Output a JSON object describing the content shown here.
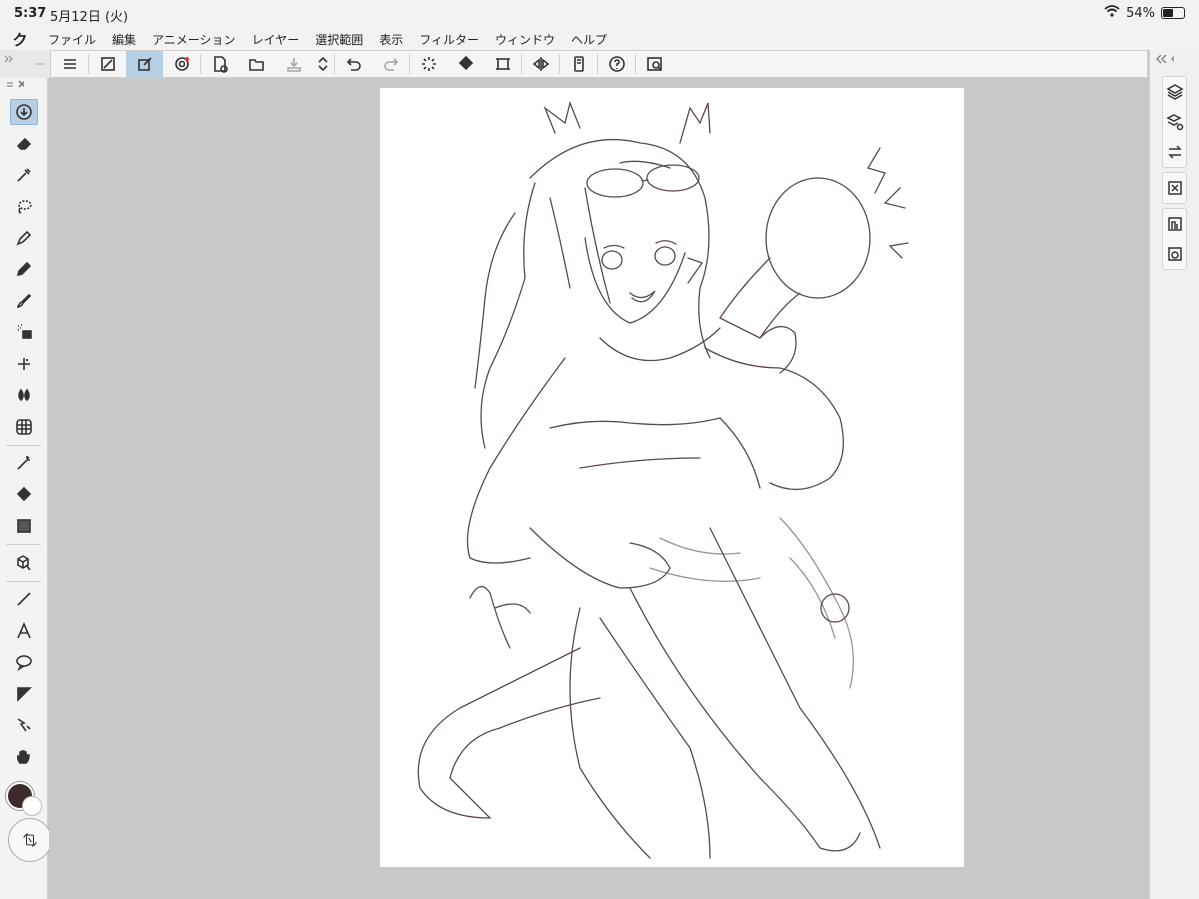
{
  "status": {
    "time": "5:37",
    "date": "5月12日 (火)",
    "battery": "54%"
  },
  "menu": [
    "ファイル",
    "編集",
    "アニメーション",
    "レイヤー",
    "選択範囲",
    "表示",
    "フィルター",
    "ウィンドウ",
    "ヘルプ"
  ],
  "colors": {
    "main": "#3d2b2c",
    "accent": "#b8d0e6",
    "ui_bg": "#f3f3f3",
    "canvas_bg": "#c8c8c8"
  },
  "toolbar_icons": [
    "menu-icon",
    "fit-view-icon",
    "quick-access-icon",
    "record-icon",
    "new-file-icon",
    "open-file-icon",
    "save-icon",
    "scroll-icon",
    "undo-icon",
    "redo-icon",
    "loading-icon",
    "fill-icon",
    "transform-icon",
    "flip-icon",
    "device-icon",
    "help-icon",
    "search-icon"
  ],
  "tool_icons": [
    "current-tool-icon",
    "eraser-icon",
    "eyedropper-icon",
    "lasso-icon",
    "pen-icon",
    "pencil-icon",
    "brush-icon",
    "airbrush-icon",
    "decoration-icon",
    "blend-icon",
    "mesh-icon",
    "auto-select-icon",
    "fill-icon",
    "gradient-icon",
    "3d-object-icon",
    "line-icon",
    "text-icon",
    "balloon-icon",
    "frame-icon",
    "correction-icon",
    "hand-icon"
  ],
  "panel_icons": [
    "layers-icon",
    "layer-props-icon",
    "history-icon",
    "navigator-icon",
    "material-icon",
    "sub-view-icon"
  ],
  "menu_logo": "ク"
}
